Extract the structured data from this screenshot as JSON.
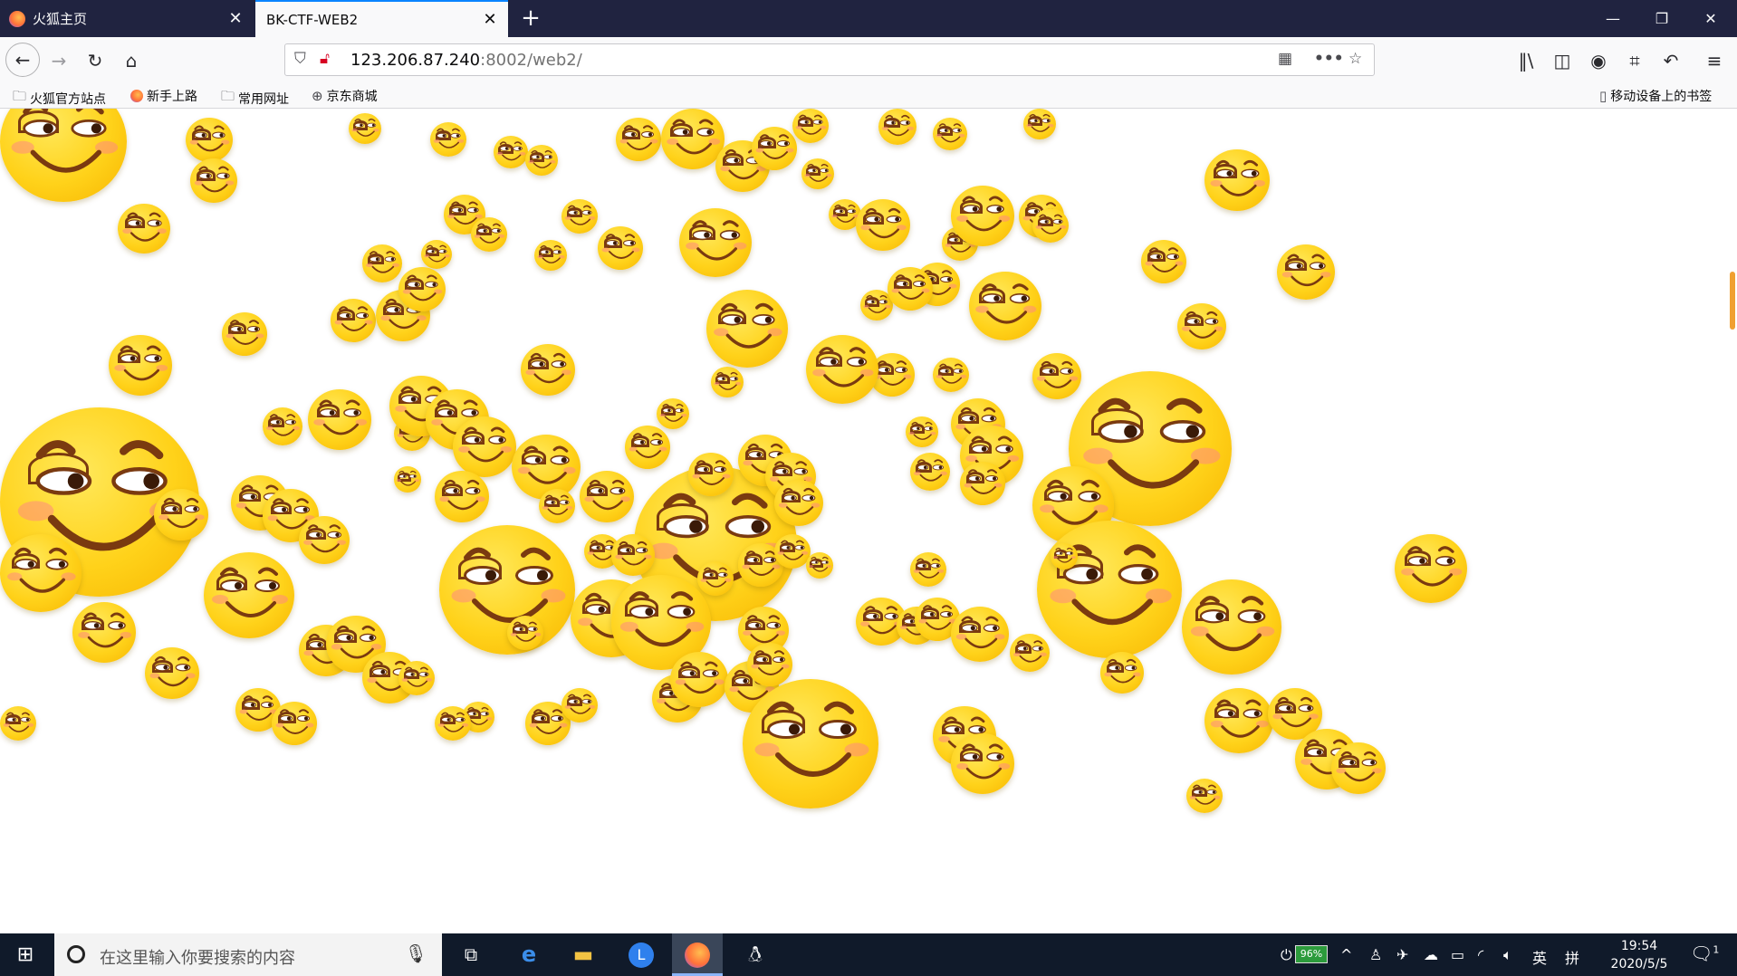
{
  "browser": {
    "tabs": [
      {
        "title": "火狐主页",
        "icon": "firefox-icon",
        "active": false
      },
      {
        "title": "BK-CTF-WEB2",
        "icon": "none",
        "active": true
      }
    ],
    "url": {
      "host": "123.206.87.240",
      "rest": ":8002/web2/"
    },
    "bookmarks": [
      {
        "label": "火狐官方站点",
        "icon": "folder-icon"
      },
      {
        "label": "新手上路",
        "icon": "firefox-icon"
      },
      {
        "label": "常用网址",
        "icon": "folder-icon"
      },
      {
        "label": "京东商城",
        "icon": "globe-icon"
      }
    ],
    "mobile_bookmarks": "移动设备上的书签"
  },
  "taskbar": {
    "search_placeholder": "在这里输入你要搜索的内容",
    "battery": "96%",
    "ime": "英",
    "ime2": "拼",
    "time": "19:54",
    "date": "2020/5/5",
    "notifications": "1"
  }
}
